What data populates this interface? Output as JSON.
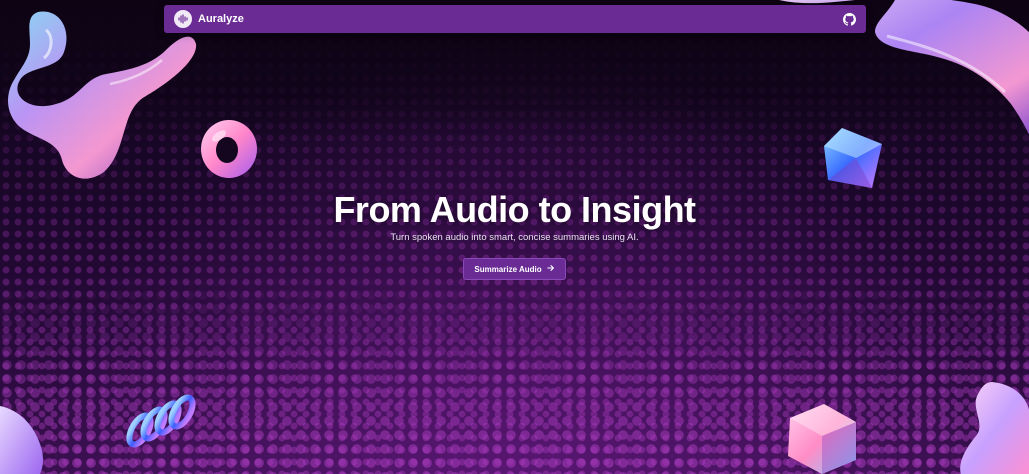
{
  "navbar": {
    "brand_name": "Auralyze",
    "logo_icon": "audio-wave-icon",
    "github_icon": "github-icon",
    "bar_color": "#6a2b95"
  },
  "hero": {
    "title": "From Audio to Insight",
    "subtitle": "Turn spoken audio into smart, concise summaries using AI.",
    "cta_label": "Summarize Audio",
    "cta_icon": "arrow-right-icon"
  },
  "theme": {
    "background": "#14061f",
    "accent": "#6a2b95",
    "dot_color": "#962fae"
  }
}
